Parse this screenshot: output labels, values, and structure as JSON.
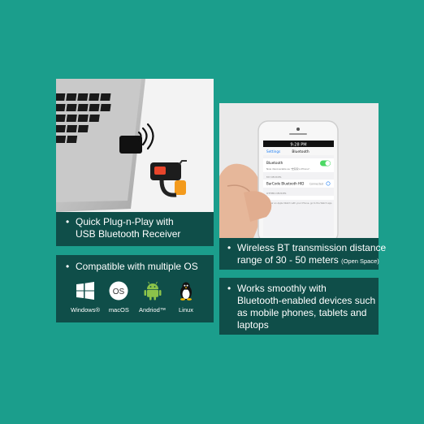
{
  "colors": {
    "background": "#1b9e8c",
    "caption_bar": "#0f4e49",
    "text": "#ffffff",
    "accent_red": "#e8452b",
    "accent_orange": "#f39a1c"
  },
  "panel_plug": {
    "bullet": "•",
    "line1": "Quick Plug-n-Play with",
    "line2": "USB Bluetooth Receiver"
  },
  "panel_os": {
    "bullet": "•",
    "title": "Compatible with multiple OS",
    "items": [
      {
        "icon": "windows-icon",
        "label": "Windows®"
      },
      {
        "icon": "macos-icon",
        "label": "macOS",
        "badge": "OS"
      },
      {
        "icon": "android-icon",
        "label": "Andriod™"
      },
      {
        "icon": "linux-icon",
        "label": "Linux"
      }
    ]
  },
  "panel_wireless": {
    "bullet": "•",
    "line1": "Wireless BT transmission distance",
    "line2": "range of 30 - 50 meters",
    "note": "(Open Space)",
    "phone": {
      "time": "9:28 PM",
      "back": "Settings",
      "title": "Bluetooth",
      "toggle_label": "Bluetooth",
      "discoverable": "Now discoverable as \"史琼琼's iPhone\".",
      "section": "MY DEVICES",
      "device": "BarCode Bluetooth HID",
      "device_status": "Connected",
      "other_section": "OTHER DEVICES",
      "footer": "To pair an Apple Watch with your iPhone, go to the Watch app."
    }
  },
  "panel_devices": {
    "bullet": "•",
    "line1": "Works smoothly with",
    "line2": "Bluetooth-enabled devices such",
    "line3": "as mobile phones, tablets and",
    "line4": "laptops"
  }
}
